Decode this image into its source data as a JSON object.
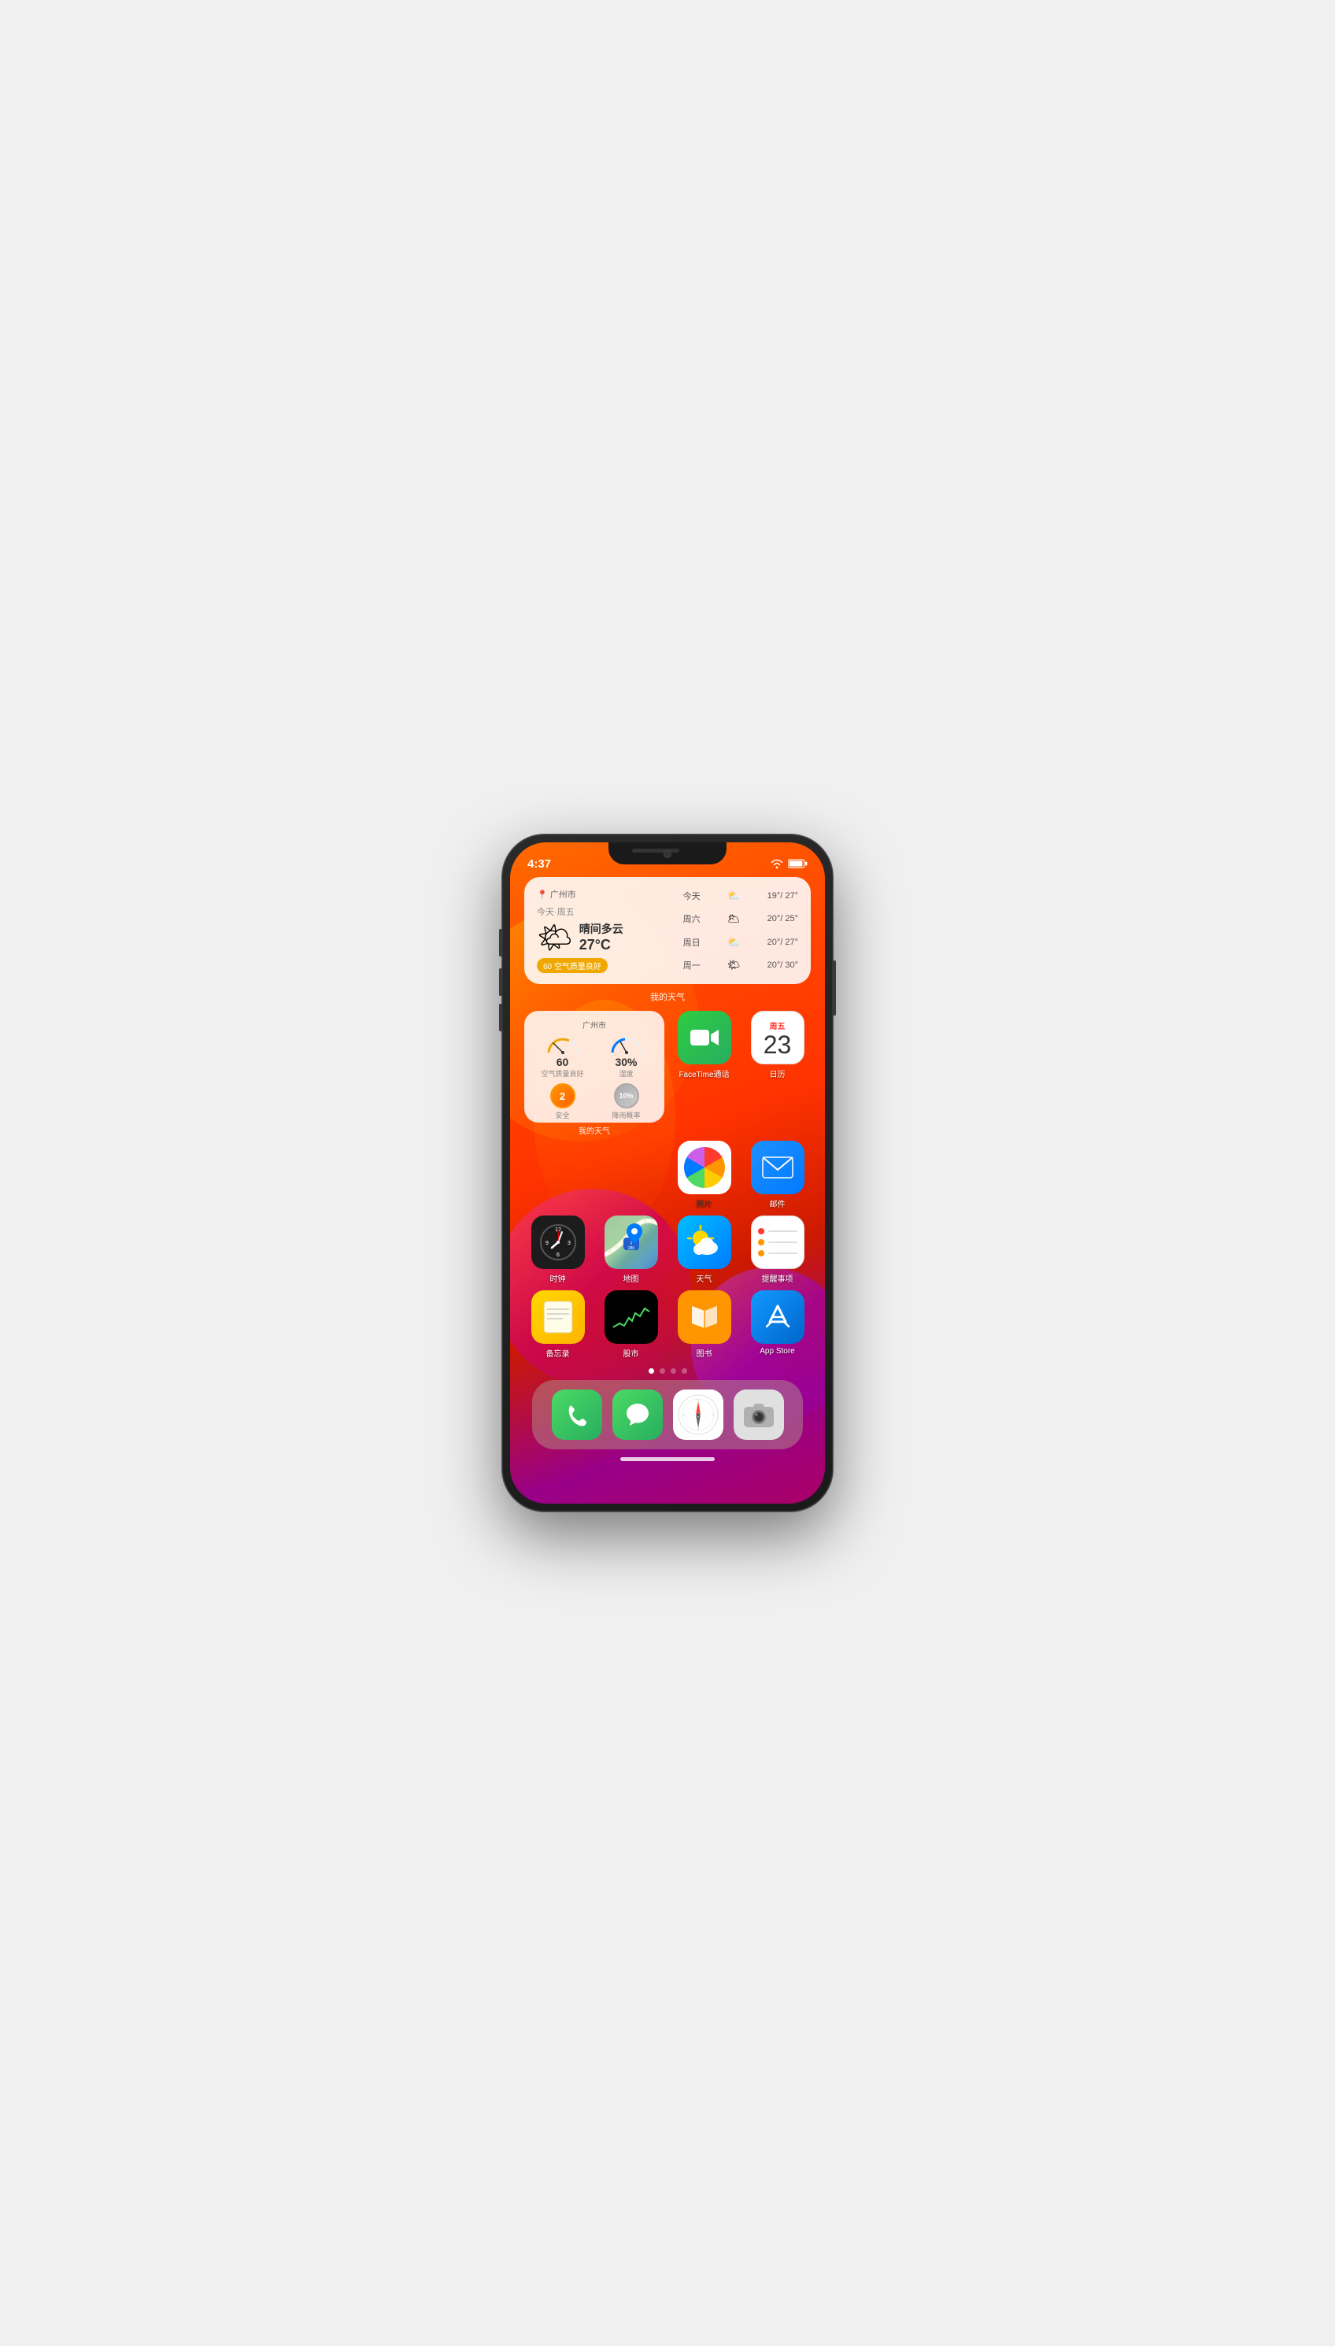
{
  "phone": {
    "status_bar": {
      "time": "4:37"
    },
    "weather_widget": {
      "location": "广州市",
      "date": "今天·周五",
      "description": "晴间多云",
      "temperature": "27°C",
      "aqi": "60 空气质量良好",
      "forecast": [
        {
          "day": "今天",
          "icon": "⛅",
          "temp": "19°/ 27°"
        },
        {
          "day": "周六",
          "icon": "🌥",
          "temp": "20°/ 25°"
        },
        {
          "day": "周日",
          "icon": "⛅",
          "temp": "20°/ 27°"
        },
        {
          "day": "周一",
          "icon": "🌤",
          "temp": "20°/ 30°"
        }
      ],
      "label": "我的天气"
    },
    "weather_mini_widget": {
      "location": "广州市",
      "aqi_value": "60",
      "aqi_label": "空气质量良好",
      "humidity_value": "30%",
      "humidity_label": "湿度",
      "uv_value": "2",
      "uv_label": "安全",
      "rain_value": "10%",
      "rain_label": "降雨概率",
      "widget_label": "我的天气"
    },
    "apps": [
      {
        "id": "facetime",
        "label": "FaceTime通话",
        "icon_type": "facetime"
      },
      {
        "id": "calendar",
        "label": "日历",
        "icon_type": "calendar",
        "day_name": "周五",
        "day_num": "23"
      },
      {
        "id": "photos",
        "label": "照片",
        "icon_type": "photos"
      },
      {
        "id": "mail",
        "label": "邮件",
        "icon_type": "mail"
      },
      {
        "id": "clock",
        "label": "时钟",
        "icon_type": "clock"
      },
      {
        "id": "maps",
        "label": "地图",
        "icon_type": "maps"
      },
      {
        "id": "weather",
        "label": "天气",
        "icon_type": "weather"
      },
      {
        "id": "reminders",
        "label": "提醒事项",
        "icon_type": "reminders"
      },
      {
        "id": "notes",
        "label": "备忘录",
        "icon_type": "notes"
      },
      {
        "id": "stocks",
        "label": "股市",
        "icon_type": "stocks"
      },
      {
        "id": "books",
        "label": "图书",
        "icon_type": "books"
      },
      {
        "id": "appstore",
        "label": "App Store",
        "icon_type": "appstore"
      }
    ],
    "dock": [
      {
        "id": "phone",
        "label": "",
        "icon_type": "phone"
      },
      {
        "id": "messages",
        "label": "",
        "icon_type": "messages"
      },
      {
        "id": "safari",
        "label": "",
        "icon_type": "safari"
      },
      {
        "id": "camera",
        "label": "",
        "icon_type": "camera"
      }
    ],
    "page_dots": [
      "active",
      "inactive",
      "inactive",
      "inactive"
    ]
  }
}
